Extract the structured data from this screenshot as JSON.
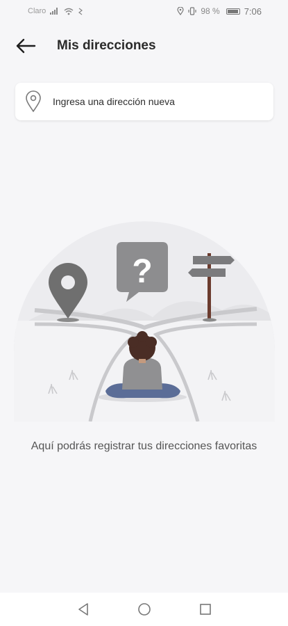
{
  "status_bar": {
    "carrier": "Claro",
    "battery": "98 %",
    "time": "7:06",
    "icons": [
      "signal-icon",
      "wifi-icon",
      "vibrate-icon",
      "location-icon",
      "battery-icon"
    ]
  },
  "header": {
    "back_icon": "arrow-left-icon",
    "title": "Mis direcciones"
  },
  "address_input": {
    "icon": "location-pin-icon",
    "placeholder": "Ingresa una dirección nueva"
  },
  "empty_state": {
    "illustration": "crossroads-question-illustration",
    "message": "Aquí podrás registrar tus direcciones favoritas"
  },
  "nav_bar": {
    "buttons": [
      "back-triangle-icon",
      "home-circle-icon",
      "recents-square-icon"
    ]
  }
}
